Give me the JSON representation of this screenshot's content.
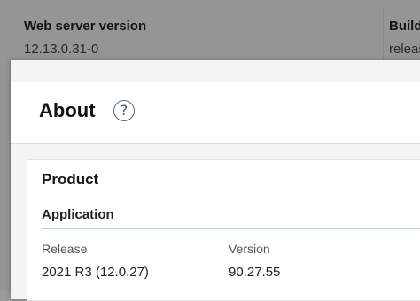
{
  "background": {
    "columns": [
      {
        "header": "Web server version",
        "value": "12.13.0.31-0"
      },
      {
        "header": "Build",
        "value": "release"
      }
    ]
  },
  "dialog": {
    "title": "About",
    "help_icon": "question-mark-circle-icon",
    "help_glyph": "?",
    "card": {
      "title": "Product",
      "section": "Application",
      "fields": [
        {
          "label": "Release",
          "value": "2021 R3 (12.0.27)"
        },
        {
          "label": "Version",
          "value": "90.27.55"
        }
      ]
    }
  },
  "colors": {
    "overlay": "#959595",
    "dialog_bg": "#f4f4f4",
    "card_bg": "#ffffff",
    "divider_accent": "#b8cfe0"
  }
}
